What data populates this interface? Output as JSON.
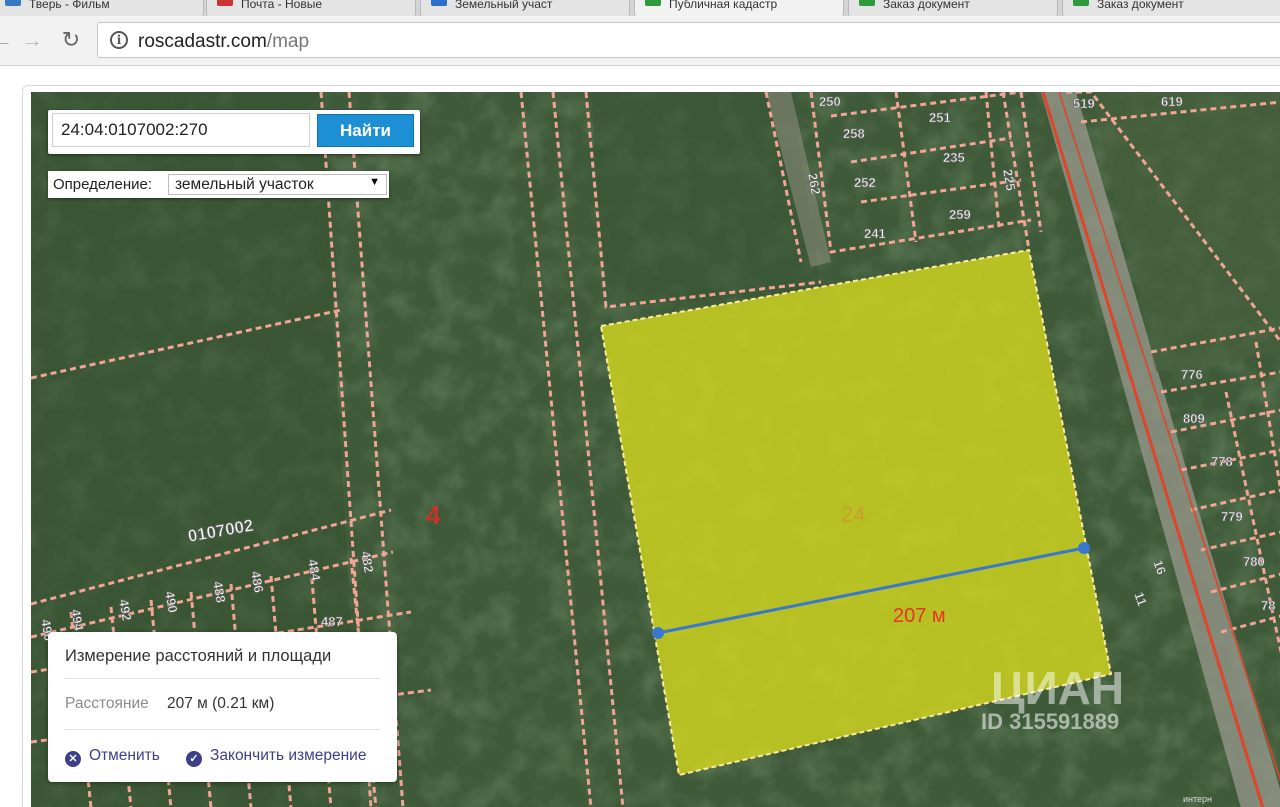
{
  "browser": {
    "tabs": [
      {
        "label": "Тверь - Фильм",
        "color": "#3a78c2"
      },
      {
        "label": "Почта - Новые",
        "color": "#cc3333"
      },
      {
        "label": "Земельный участ",
        "color": "#2a6fc9"
      },
      {
        "label": "Публичная кадастр",
        "color": "#2e9a3c"
      },
      {
        "label": "Заказ документ",
        "color": "#2e9a3c"
      },
      {
        "label": "Заказ документ",
        "color": "#2e9a3c"
      }
    ],
    "url_domain": "roscadastr.com",
    "url_path": "/map"
  },
  "search": {
    "value": "24:04:0107002:270",
    "button_label": "Найти"
  },
  "definition": {
    "label": "Определение:",
    "value": "земельный участок"
  },
  "measurement": {
    "title": "Измерение расстояний и площади",
    "distance_label": "Расстояние",
    "distance_value": "207 м (0.21 км)",
    "cancel_label": "Отменить",
    "finish_label": "Закончить измерение"
  },
  "map": {
    "line_label": "207 м",
    "plot_number": "24",
    "quarter_label": "0107002",
    "block_number": "4",
    "parcels_top": [
      "250",
      "251",
      "258",
      "235",
      "252",
      "259",
      "241",
      "262",
      "225",
      "519",
      "619"
    ],
    "parcels_right": [
      "776",
      "809",
      "778",
      "779",
      "780",
      "78",
      "11",
      "16"
    ],
    "parcels_left": [
      "482",
      "484",
      "486",
      "488",
      "490",
      "492",
      "494",
      "496",
      "487"
    ],
    "watermark_brand": "ЦИАН",
    "watermark_id": "ID 315591889",
    "corner_text": "интерн",
    "highlight_color": "#d9dd1c",
    "measure_color": "#3a78d0"
  }
}
